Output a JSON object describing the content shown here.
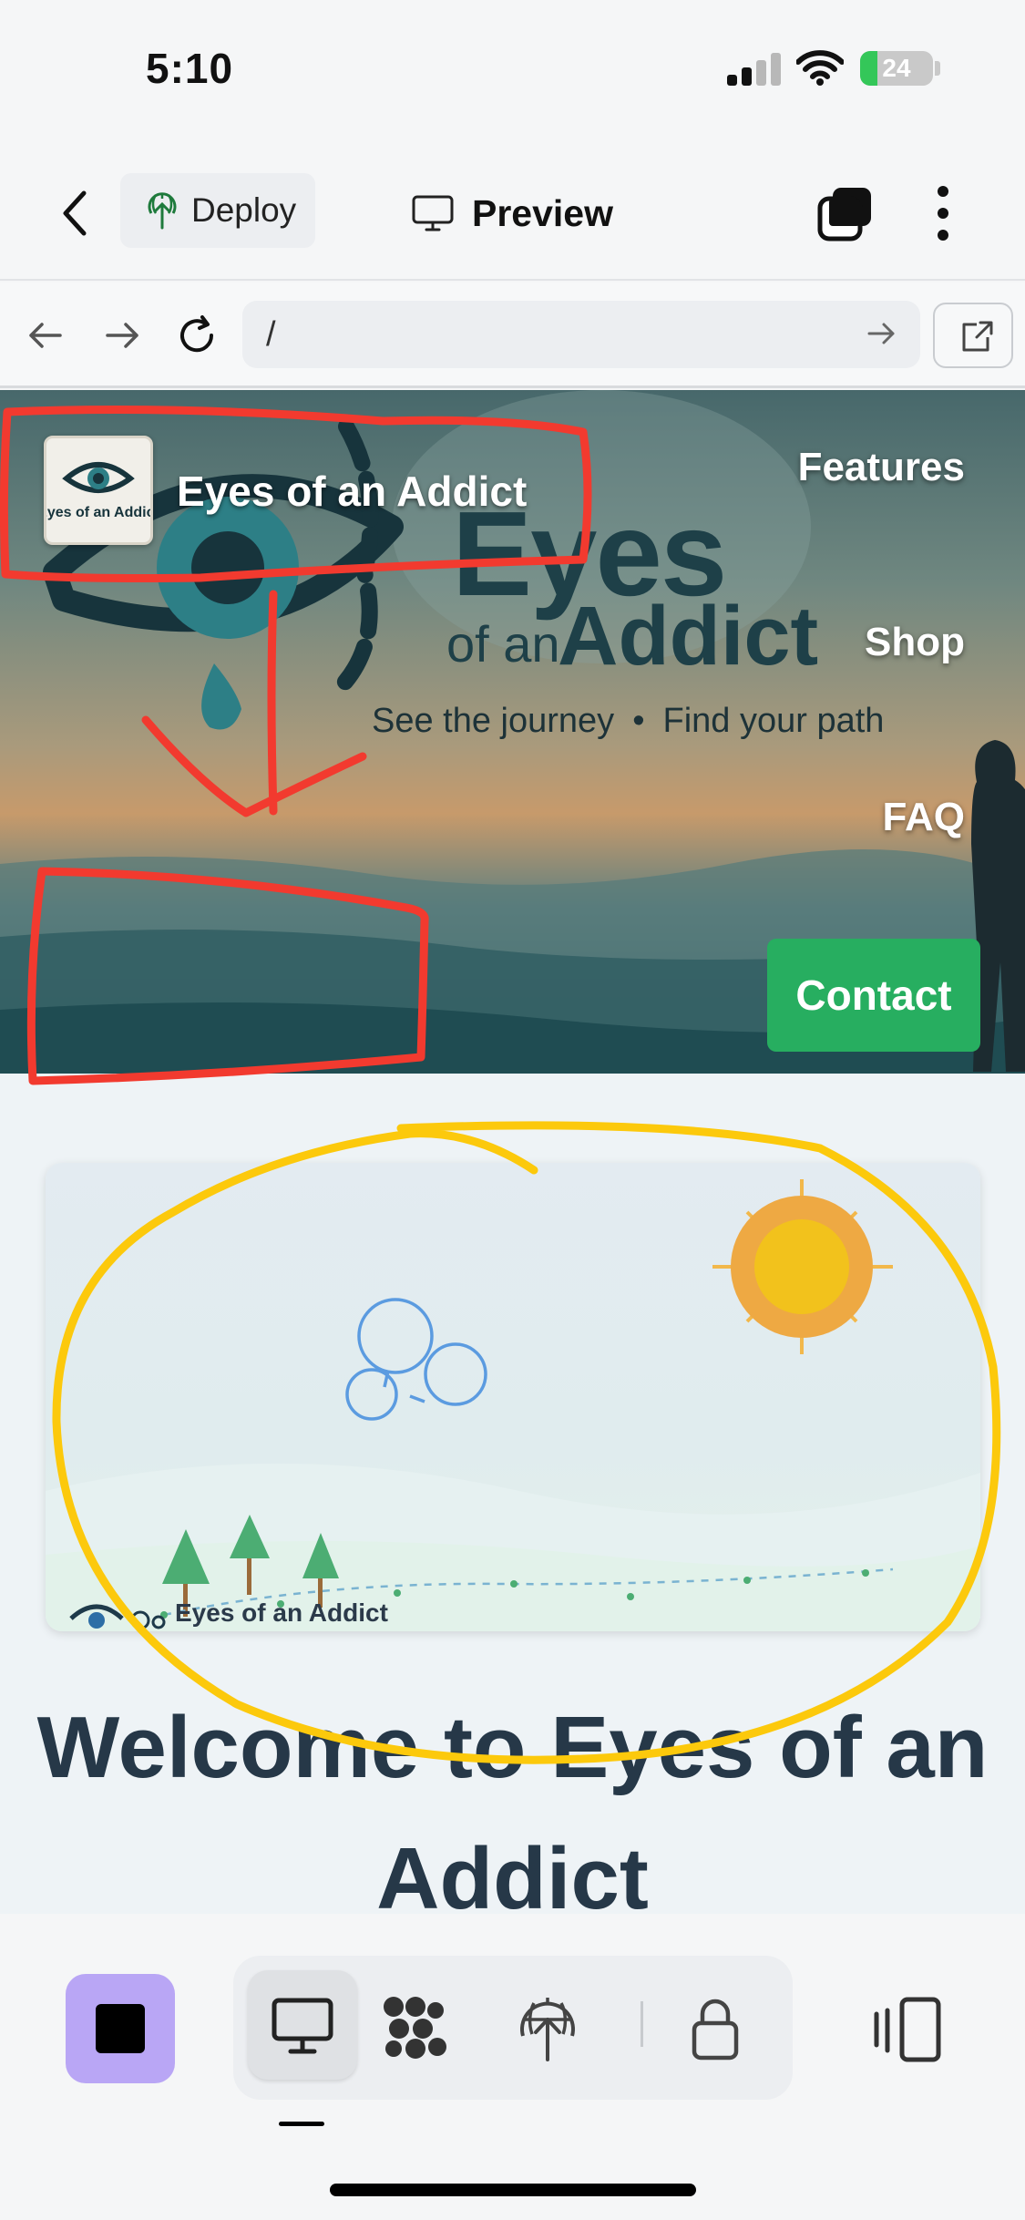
{
  "status_bar": {
    "time": "5:10",
    "battery_pct": "24",
    "battery_level": 0.24
  },
  "toolbar": {
    "deploy_label": "Deploy",
    "preview_label": "Preview"
  },
  "browser": {
    "url": "/"
  },
  "site": {
    "title": "Eyes of an Addict",
    "logo_text": "Eyes of an Addict",
    "hero_brand": {
      "eyes": "Eyes",
      "of_an": "of an",
      "addict": "Addict"
    },
    "tagline": {
      "part1": "See the journey",
      "separator": "•",
      "part2": "Find your path"
    },
    "nav": {
      "features": "Features",
      "shop": "Shop",
      "faq": "FAQ",
      "contact": "Contact"
    },
    "scene_caption": "Eyes of an Addict",
    "welcome_heading": "Welcome to Eyes of an Addict"
  },
  "colors": {
    "contact_button": "#27ae60",
    "annotation_red": "#f23a2f",
    "annotation_yellow": "#fcc90c",
    "stop_button": "#b9a6f5"
  },
  "dock": {
    "icons": [
      "stop-icon",
      "desktop-icon",
      "bubbles-icon",
      "deploy-icon",
      "lock-icon",
      "device-toggle-icon"
    ],
    "active": "desktop-icon"
  }
}
